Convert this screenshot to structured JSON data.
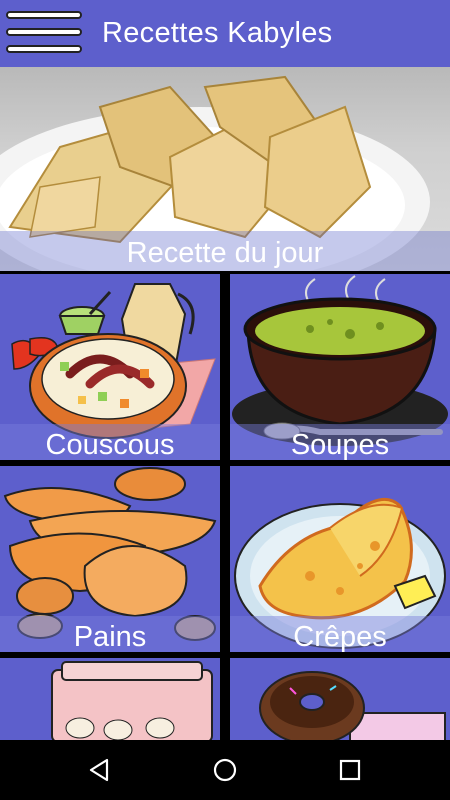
{
  "app": {
    "title": "Recettes Kabyles"
  },
  "menu_icon": "hamburger-menu-icon",
  "hero": {
    "label": "Recette du jour"
  },
  "tiles": [
    {
      "label": "Couscous"
    },
    {
      "label": "Soupes"
    },
    {
      "label": "Pains"
    },
    {
      "label": "Crêpes"
    },
    {
      "label": ""
    },
    {
      "label": ""
    }
  ],
  "navbar": {
    "icons": [
      "back-triangle-icon",
      "home-circle-icon",
      "recents-square-icon"
    ]
  },
  "colors": {
    "appbar": "#5d5fcc",
    "tile_background": "#5d5fcc",
    "navbar": "#000000"
  }
}
